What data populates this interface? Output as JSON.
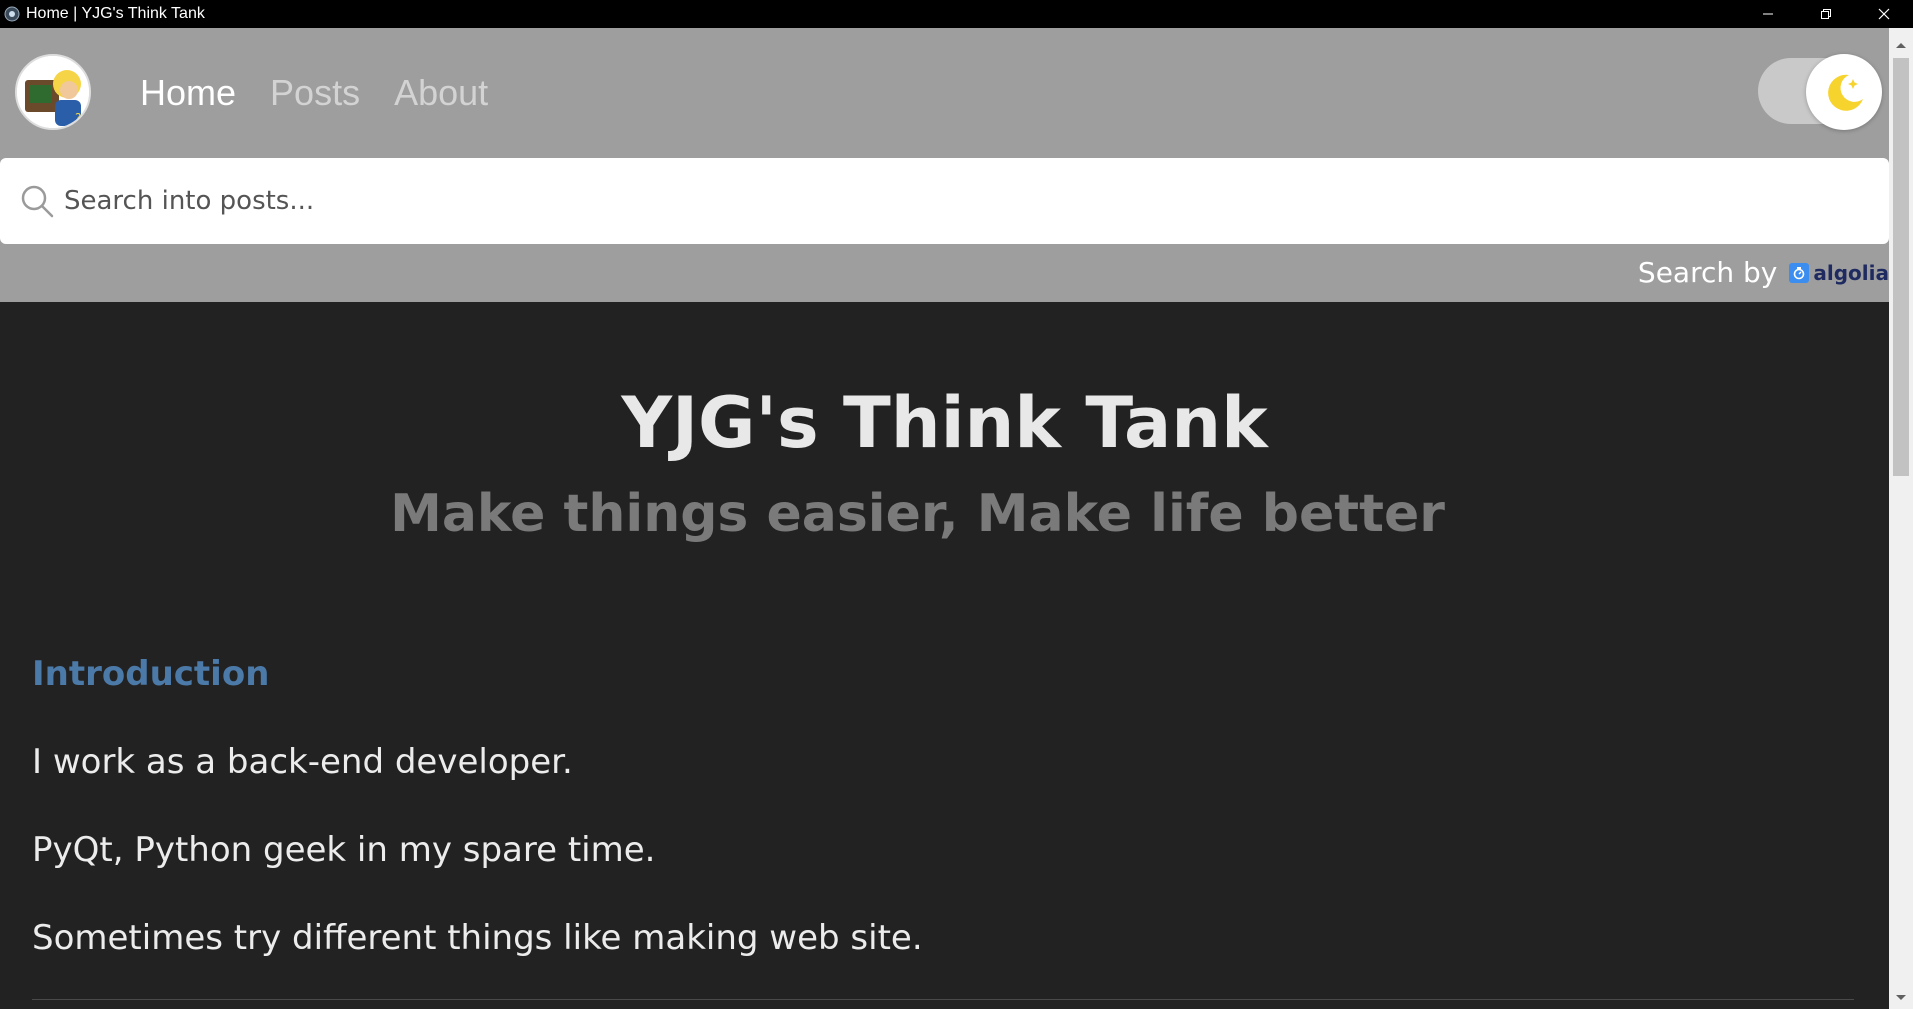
{
  "window": {
    "title": "Home | YJG's Think Tank"
  },
  "nav": {
    "items": [
      {
        "label": "Home",
        "active": true
      },
      {
        "label": "Posts",
        "active": false
      },
      {
        "label": "About",
        "active": false
      }
    ]
  },
  "theme_toggle": {
    "mode": "dark",
    "icon": "moon-icon"
  },
  "search": {
    "placeholder": "Search into posts...",
    "value": "",
    "powered_by_label": "Search by",
    "provider": "algolia"
  },
  "hero": {
    "title": "YJG's Think Tank",
    "subtitle": "Make things easier, Make life better"
  },
  "intro": {
    "heading": "Introduction",
    "paragraphs": [
      "I work as a back-end developer.",
      "PyQt, Python geek in my spare time.",
      "Sometimes try different things like making web site."
    ]
  },
  "colors": {
    "header_bg": "#9e9e9e",
    "page_bg": "#222222",
    "heading_accent": "#4b79a8",
    "algolia_blue": "#3c8df0"
  }
}
